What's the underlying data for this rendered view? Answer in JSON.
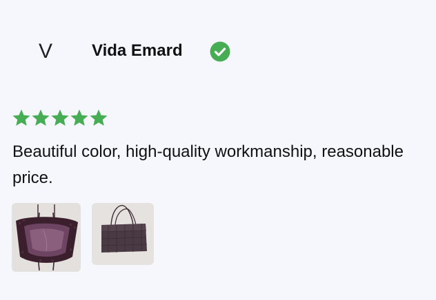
{
  "review": {
    "avatar_initial": "V",
    "reviewer_name": "Vida Emard",
    "verified_icon": "check-circle-icon",
    "rating": 5,
    "rating_max": 5,
    "text": "Beautiful color, high-quality workmanship, reasonable price.",
    "photos": [
      {
        "icon": "photo-bag-interior"
      },
      {
        "icon": "photo-bag-side"
      }
    ]
  },
  "colors": {
    "background": "#f6f7fc",
    "accent_green": "#47ad54",
    "text": "#111111"
  }
}
